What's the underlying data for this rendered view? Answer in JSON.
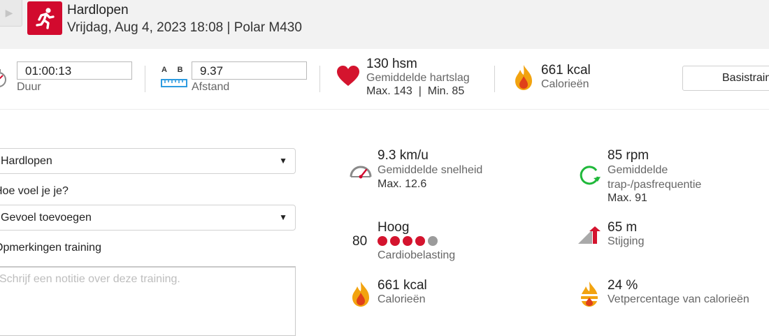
{
  "header": {
    "back_glyph": "▶",
    "sport": "Hardlopen",
    "subtitle": "Vrijdag, Aug 4, 2023 18:08 | Polar M430"
  },
  "summary": {
    "duration_value": "01:00:13",
    "duration_label": "Duur",
    "distance_ab_a": "A",
    "distance_ab_b": "B",
    "distance_value": "9.37",
    "distance_label": "Afstand",
    "heart_value": "130 hsm",
    "heart_label": "Gemiddelde hartslag",
    "heart_minmax": "Max. 143  |  Min. 85",
    "calories_value": "661 kcal",
    "calories_label": "Calorieën",
    "basis_button": "Basistraining"
  },
  "form": {
    "sport_select": "Hardlopen",
    "feeling_label": "Hoe voel je je?",
    "feeling_select": "Gevoel toevoegen",
    "notes_label": "Opmerkingen training",
    "notes_placeholder": "Schrijf een notitie over deze training."
  },
  "stats": {
    "speed_value": "9.3 km/u",
    "speed_label": "Gemiddelde snelheid",
    "speed_max": "Max. 12.6",
    "cadence_value": "85 rpm",
    "cadence_label_1": "Gemiddelde",
    "cadence_label_2": "trap-/pasfrequentie",
    "cadence_max": "Max. 91",
    "load_number": "80",
    "load_level": "Hoog",
    "load_label": "Cardiobelasting",
    "load_dots_filled": 4,
    "load_dots_total": 5,
    "ascent_value": "65 m",
    "ascent_label": "Stijging",
    "cal_value": "661 kcal",
    "cal_label": "Calorieën",
    "fat_value": "24 %",
    "fat_label": "Vetpercentage van calorieën"
  },
  "colors": {
    "brand_red": "#d20a2e",
    "dot_filled": "#d4142e",
    "dot_empty": "#9b9b9b",
    "cadence_green": "#1fb83a",
    "ruler_blue": "#2d9be0"
  }
}
